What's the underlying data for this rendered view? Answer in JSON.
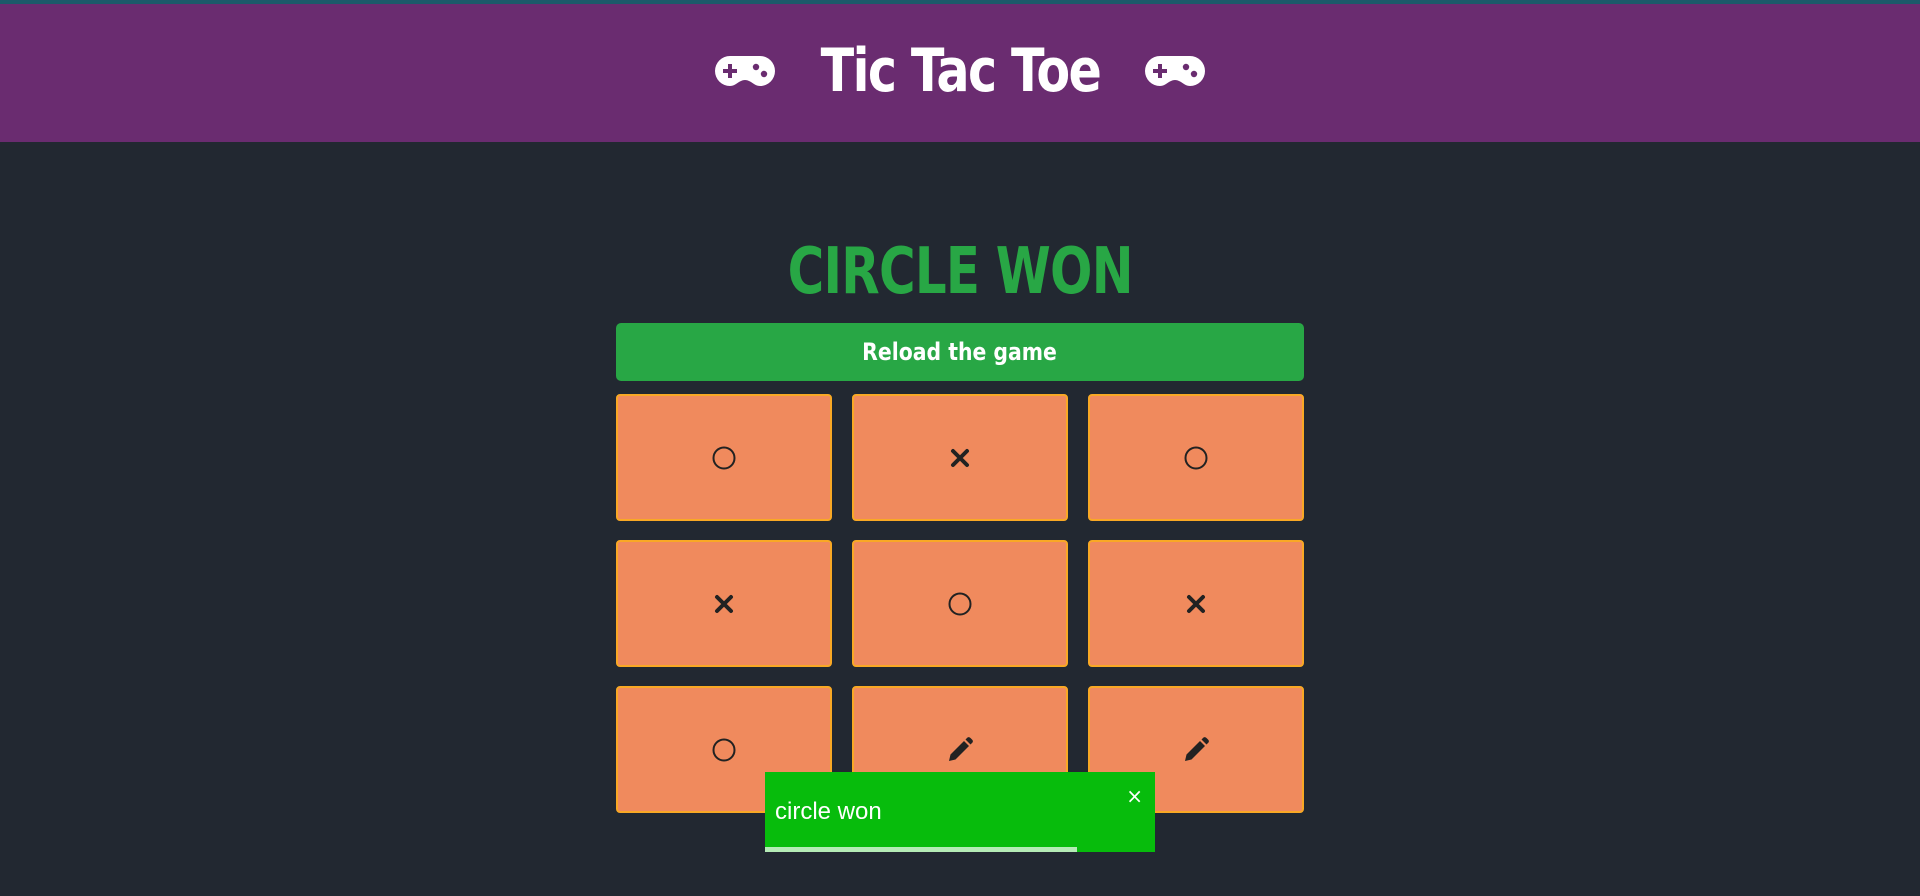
{
  "header": {
    "title": "Tic Tac Toe",
    "left_icon": "gamepad-icon",
    "right_icon": "gamepad-icon",
    "background_color": "#6a2c70"
  },
  "status": {
    "text": "CIRCLE WON",
    "color": "#28a745"
  },
  "reload_button": {
    "label": "Reload the game",
    "color": "#28a745"
  },
  "board": {
    "cell_color": "#f08a5d",
    "cell_border_color": "#f9a825",
    "cells": [
      "circle",
      "cross",
      "circle",
      "cross",
      "circle",
      "cross",
      "circle",
      "pen",
      "pen"
    ]
  },
  "toast": {
    "message": "circle won",
    "close_label": "×",
    "progress": 0.8,
    "color": "#07bc0c"
  }
}
